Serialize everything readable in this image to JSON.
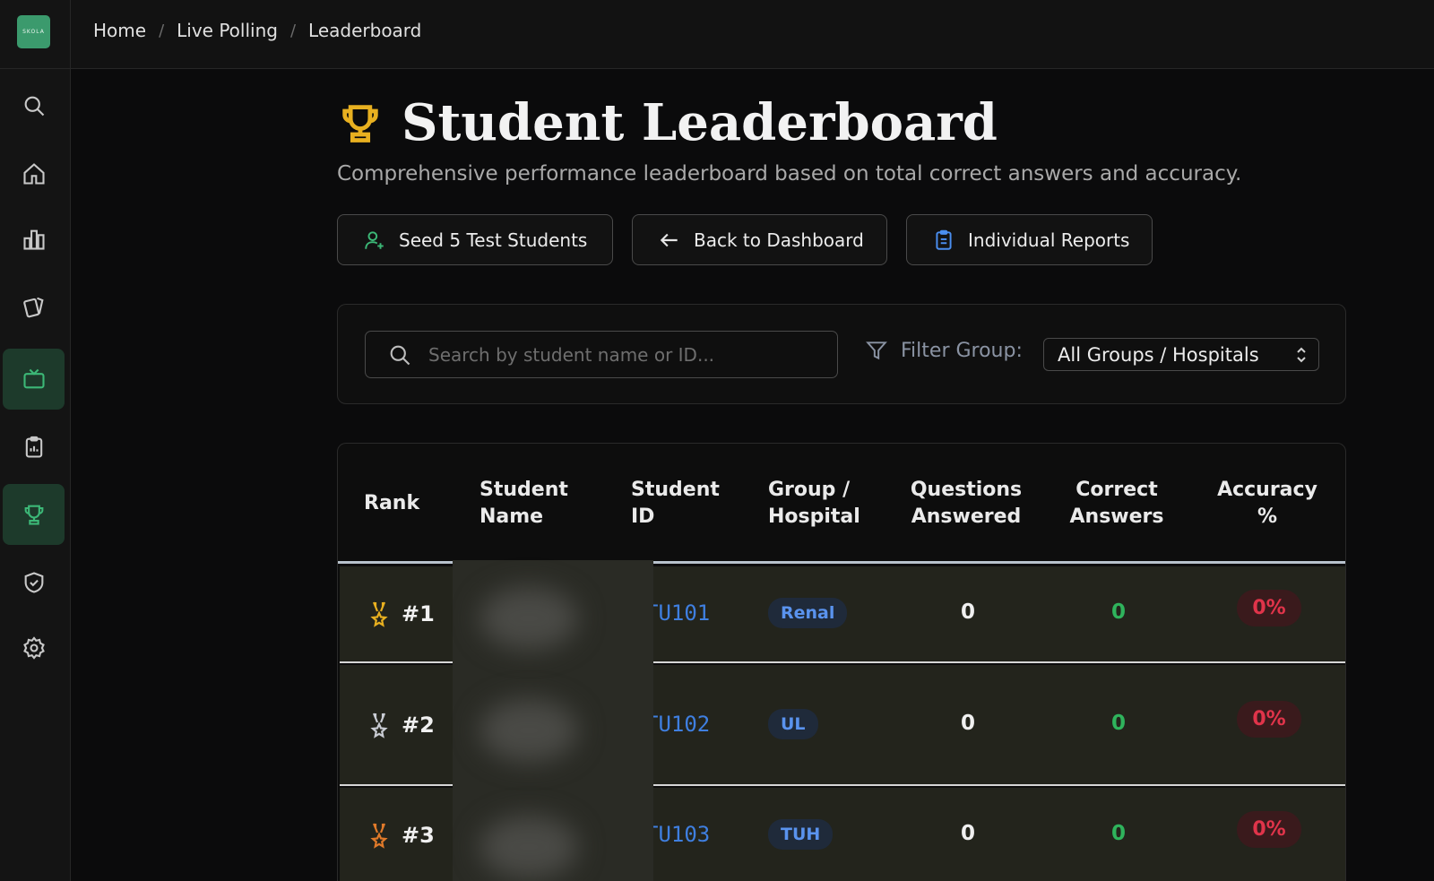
{
  "app": {
    "logo_text": "SKOLA"
  },
  "breadcrumb": [
    "Home",
    "Live Polling",
    "Leaderboard"
  ],
  "sidebar": {
    "items": [
      {
        "icon": "search-icon"
      },
      {
        "icon": "home-icon"
      },
      {
        "icon": "bar-chart-icon"
      },
      {
        "icon": "cards-icon"
      },
      {
        "icon": "tv-icon",
        "active": true
      },
      {
        "icon": "clipboard-icon"
      },
      {
        "icon": "trophy-icon",
        "active": true
      },
      {
        "icon": "shield-check-icon"
      },
      {
        "icon": "gear-icon"
      }
    ]
  },
  "header": {
    "title": "Student Leaderboard",
    "subtitle": "Comprehensive performance leaderboard based on total correct answers and accuracy."
  },
  "actions": {
    "seed": "Seed 5 Test Students",
    "back": "Back to Dashboard",
    "reports": "Individual Reports"
  },
  "filters": {
    "search_placeholder": "Search by student name or ID...",
    "filter_label": "Filter Group:",
    "group_selected": "All Groups / Hospitals"
  },
  "table": {
    "columns": {
      "rank": "Rank",
      "name_1": "Student",
      "name_2": "Name",
      "id_1": "Student",
      "id_2": "ID",
      "group_1": "Group /",
      "group_2": "Hospital",
      "questions_1": "Questions",
      "questions_2": "Answered",
      "correct_1": "Correct",
      "correct_2": "Answers",
      "accuracy_1": "Accuracy",
      "accuracy_2": "%"
    },
    "rows": [
      {
        "rank": "#1",
        "id": "TU101",
        "group": "Renal",
        "questions": "0",
        "correct": "0",
        "accuracy": "0%"
      },
      {
        "rank": "#2",
        "id": "TU102",
        "group": "UL",
        "questions": "0",
        "correct": "0",
        "accuracy": "0%"
      },
      {
        "rank": "#3",
        "id": "TU103",
        "group": "TUH",
        "questions": "0",
        "correct": "0",
        "accuracy": "0%"
      }
    ]
  },
  "colors": {
    "accent_green": "#3b9a6d",
    "gold": "#e8b020",
    "silver": "#c9ccd3",
    "bronze": "#e07a2a",
    "id_blue": "#3f7fe0",
    "correct_green": "#2fb35c",
    "accuracy_red": "#e0344a"
  }
}
